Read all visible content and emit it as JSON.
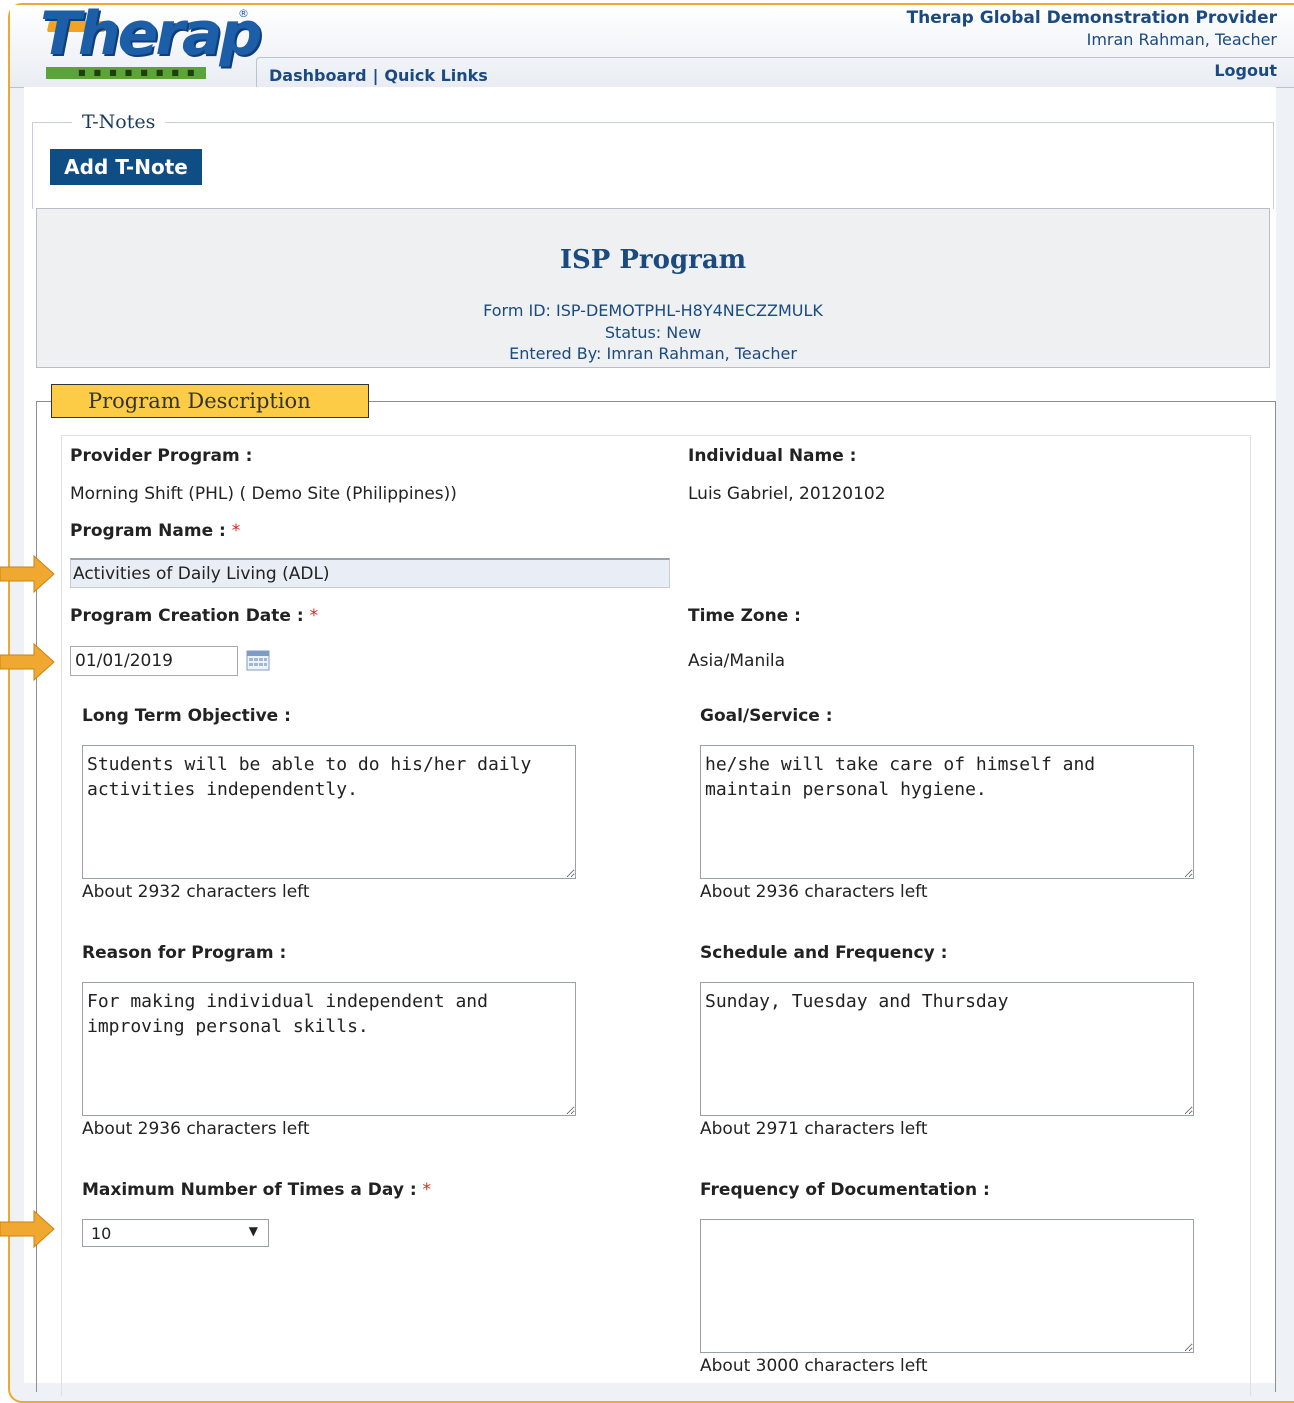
{
  "header": {
    "provider": "Therap Global Demonstration Provider",
    "user": "Imran Rahman, Teacher",
    "logout": "Logout",
    "nav": {
      "dashboard": "Dashboard",
      "separator": "|",
      "quick_links": "Quick Links"
    },
    "logo_text": "Therap"
  },
  "tnotes": {
    "legend": "T-Notes",
    "add_button": "Add T-Note"
  },
  "isp": {
    "title": "ISP Program",
    "form_id": "Form ID: ISP-DEMOTPHL-H8Y4NECZZMULK",
    "status": "Status: New",
    "entered_by": "Entered By: Imran Rahman, Teacher"
  },
  "program_description": {
    "legend": "Program Description",
    "provider_program_label": "Provider Program :",
    "provider_program_value": "Morning Shift (PHL) ( Demo Site (Philippines))",
    "individual_name_label": "Individual Name :",
    "individual_name_value": "Luis Gabriel, 20120102",
    "program_name_label": "Program Name :",
    "program_name_value": "Activities of Daily Living (ADL)",
    "creation_date_label": "Program Creation Date :",
    "creation_date_value": "01/01/2019",
    "time_zone_label": "Time Zone :",
    "time_zone_value": "Asia/Manila",
    "required_mark": "*",
    "long_term_label": "Long Term Objective :",
    "long_term_value": "Students will be able to do his/her daily activities independently.",
    "long_term_hint": "About 2932 characters left",
    "goal_label": "Goal/Service :",
    "goal_value": "he/she will take care of himself and maintain personal hygiene.",
    "goal_hint": "About 2936 characters left",
    "reason_label": "Reason for Program :",
    "reason_value": "For making individual independent and improving personal skills.",
    "reason_hint": "About 2936 characters left",
    "schedule_label": "Schedule and Frequency :",
    "schedule_value": "Sunday, Tuesday and Thursday",
    "schedule_hint": "About 2971 characters left",
    "max_times_label": "Maximum Number of Times a Day :",
    "max_times_value": "10",
    "frequency_doc_label": "Frequency of Documentation :",
    "frequency_doc_value": "",
    "frequency_doc_hint": "About 3000 characters left"
  },
  "colors": {
    "accent_orange": "#f0a830",
    "brand_blue": "#1a4a80",
    "legend_yellow": "#fccc47",
    "button_blue": "#0f4e85"
  },
  "icons": [
    "calendar-icon",
    "dropdown-arrow-icon",
    "annotation-arrow-icon"
  ]
}
